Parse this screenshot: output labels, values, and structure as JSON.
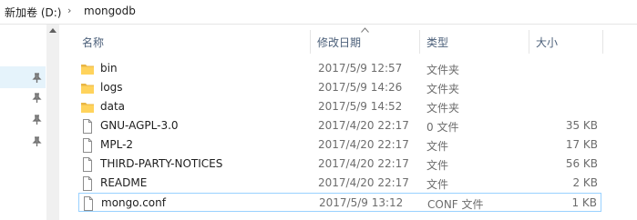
{
  "breadcrumb": {
    "drive": "新加卷 (D:)",
    "separator": "›",
    "folder": "mongodb"
  },
  "columns": {
    "name": "名称",
    "date": "修改日期",
    "type": "类型",
    "size": "大小"
  },
  "files": [
    {
      "name": "bin",
      "date": "2017/5/9 12:57",
      "type": "文件夹",
      "size": "",
      "icon": "folder-icon"
    },
    {
      "name": "logs",
      "date": "2017/5/9 14:26",
      "type": "文件夹",
      "size": "",
      "icon": "folder-icon"
    },
    {
      "name": "data",
      "date": "2017/5/9 14:52",
      "type": "文件夹",
      "size": "",
      "icon": "folder-icon"
    },
    {
      "name": "GNU-AGPL-3.0",
      "date": "2017/4/20 22:17",
      "type": "0 文件",
      "size": "35 KB",
      "icon": "file-icon"
    },
    {
      "name": "MPL-2",
      "date": "2017/4/20 22:17",
      "type": "文件",
      "size": "17 KB",
      "icon": "file-icon"
    },
    {
      "name": "THIRD-PARTY-NOTICES",
      "date": "2017/4/20 22:17",
      "type": "文件",
      "size": "56 KB",
      "icon": "file-icon"
    },
    {
      "name": "README",
      "date": "2017/4/20 22:17",
      "type": "文件",
      "size": "2 KB",
      "icon": "file-icon"
    },
    {
      "name": "mongo.conf",
      "date": "2017/5/9 13:12",
      "type": "CONF 文件",
      "size": "1 KB",
      "icon": "file-icon",
      "focused": true
    }
  ],
  "colors": {
    "folder": "#ffd35c",
    "selection_border": "#99d1ff",
    "nav_selection": "#e5f3fb",
    "header_text": "#4c607a"
  }
}
